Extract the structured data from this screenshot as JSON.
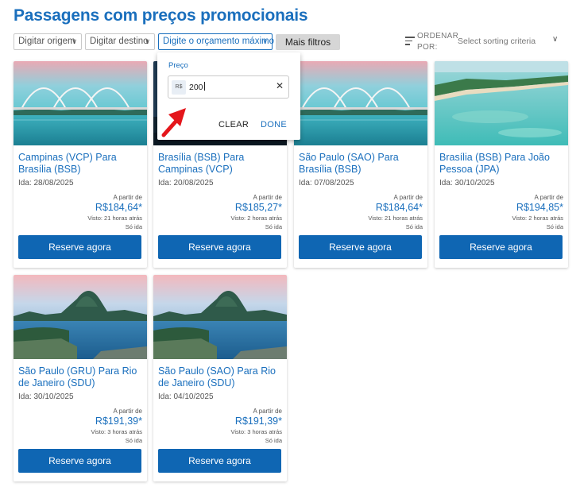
{
  "page": {
    "title": "Passagens com preços promocionais"
  },
  "filters": {
    "origin_placeholder": "Digitar origem",
    "destination_placeholder": "Digitar destino",
    "budget_placeholder": "Digite o orçamento máximo",
    "more_filters": "Mais filtros"
  },
  "sort": {
    "label": "ORDENAR POR:",
    "placeholder": "Select sorting criteria"
  },
  "price_popup": {
    "label": "Preço",
    "currency": "R$",
    "value": "200",
    "clear": "CLEAR",
    "done": "DONE"
  },
  "colors": {
    "accent": "#1a6fbd",
    "button": "#0f66b3",
    "annotation_arrow": "#e4161b"
  },
  "cards": [
    {
      "route": "Campinas (VCP) Para Brasília (BSB)",
      "date": "Ida: 28/08/2025",
      "from": "A partir de",
      "price": "R$184,64*",
      "seen": "Visto: 21 horas atrás",
      "trip": "Só ida",
      "cta": "Reserve agora",
      "image": "brasilia-bridge"
    },
    {
      "route": "Brasília (BSB) Para Campinas (VCP)",
      "date": "Ida: 20/08/2025",
      "from": "A partir de",
      "price": "R$185,27*",
      "seen": "Visto: 2 horas atrás",
      "trip": "Só ida",
      "cta": "Reserve agora",
      "image": "city-skyline"
    },
    {
      "route": "São Paulo (SAO) Para Brasília (BSB)",
      "date": "Ida: 07/08/2025",
      "from": "A partir de",
      "price": "R$184,64*",
      "seen": "Visto: 21 horas atrás",
      "trip": "Só ida",
      "cta": "Reserve agora",
      "image": "brasilia-bridge"
    },
    {
      "route": "Brasília (BSB) Para João Pessoa (JPA)",
      "date": "Ida: 30/10/2025",
      "from": "A partir de",
      "price": "R$194,85*",
      "seen": "Visto: 2 horas atrás",
      "trip": "Só ida",
      "cta": "Reserve agora",
      "image": "joao-pessoa-beach"
    },
    {
      "route": "São Paulo (GRU) Para Rio de Janeiro (SDU)",
      "date": "Ida: 30/10/2025",
      "from": "A partir de",
      "price": "R$191,39*",
      "seen": "Visto: 3 horas atrás",
      "trip": "Só ida",
      "cta": "Reserve agora",
      "image": "rio-sugarloaf"
    },
    {
      "route": "São Paulo (SAO) Para Rio de Janeiro (SDU)",
      "date": "Ida: 04/10/2025",
      "from": "A partir de",
      "price": "R$191,39*",
      "seen": "Visto: 3 horas atrás",
      "trip": "Só ida",
      "cta": "Reserve agora",
      "image": "rio-sugarloaf"
    }
  ]
}
